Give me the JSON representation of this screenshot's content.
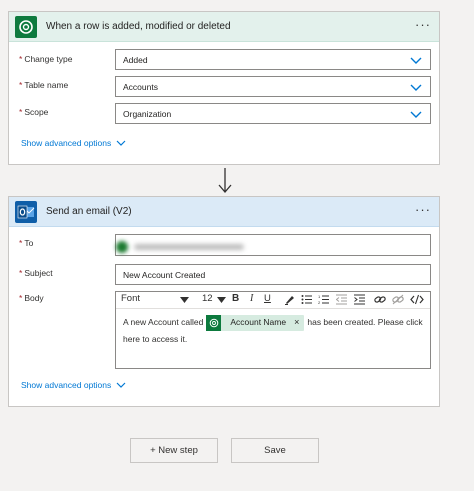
{
  "trigger": {
    "title": "When a row is added, modified or deleted",
    "menu_glyph": "···",
    "icon": "dataverse-icon",
    "fields": [
      {
        "label": "Change type",
        "value": "Added"
      },
      {
        "label": "Table name",
        "value": "Accounts"
      },
      {
        "label": "Scope",
        "value": "Organization"
      }
    ],
    "advanced_label": "Show advanced options"
  },
  "action": {
    "title": "Send an email (V2)",
    "menu_glyph": "···",
    "icon": "outlook-icon",
    "to_label": "To",
    "subject_label": "Subject",
    "subject_value": "New Account Created",
    "body_label": "Body",
    "toolbar": {
      "font": "Font",
      "size": "12"
    },
    "body_text_before": "A new Account called",
    "token_label": "Account Name",
    "token_close": "×",
    "body_text_after": "has been created. Please click here to access it.",
    "advanced_label": "Show advanced options"
  },
  "buttons": {
    "new_step": "+ New step",
    "save": "Save"
  },
  "colors": {
    "accent": "#0078d4",
    "dataverse_green": "#0d7a3e",
    "outlook_blue": "#0f5ea8",
    "required": "#a4262c"
  }
}
